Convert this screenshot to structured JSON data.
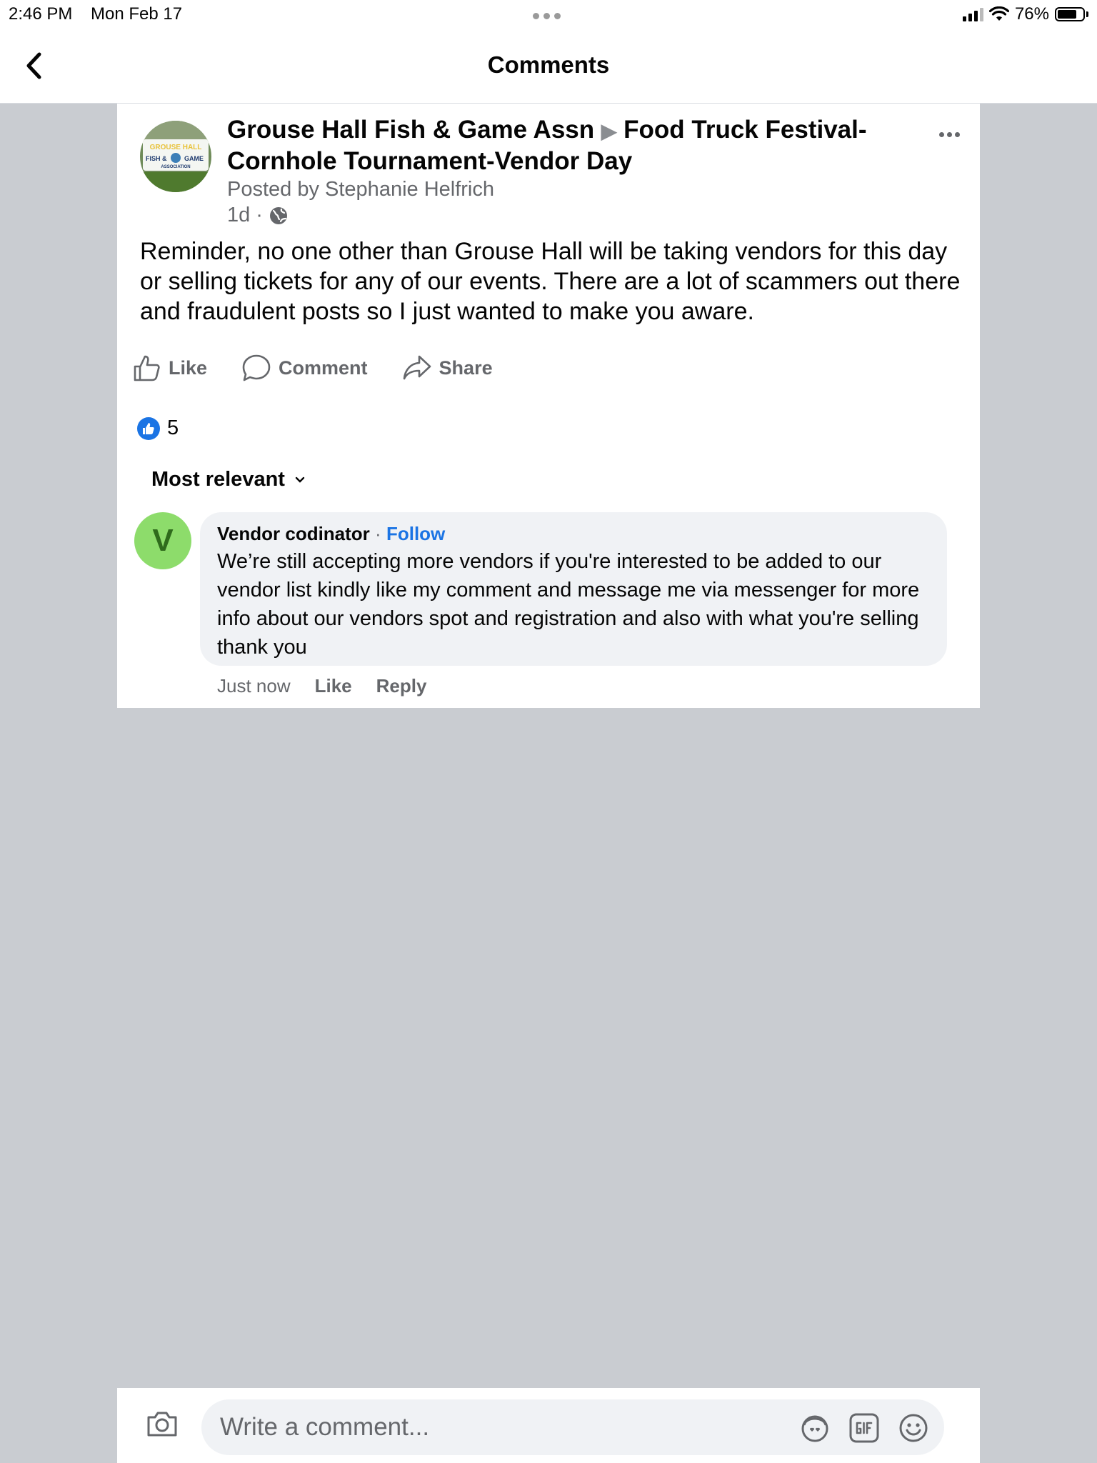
{
  "status_bar": {
    "time": "2:46 PM",
    "date": "Mon Feb 17",
    "battery": "76%"
  },
  "nav": {
    "title": "Comments",
    "back_icon": "chevron-left-icon"
  },
  "post": {
    "page_name": "Grouse Hall Fish & Game Assn",
    "event_name": "Food Truck Festival-Cornhole Tournament-Vendor Day",
    "posted_by": "Posted by Stephanie Helfrich",
    "time": "1d",
    "text": "Reminder, no one other than Grouse Hall will be taking vendors for this day or selling tickets for any of our events. There are a lot of scammers out there and fraudulent posts so I just wanted to make you aware.",
    "logo": {
      "text_top": "GROUSE HALL",
      "text_left": "FISH &",
      "text_right": "GAME",
      "text_bottom": "ASSOCIATION"
    },
    "actions": {
      "like": "Like",
      "comment": "Comment",
      "share": "Share"
    },
    "reaction_count": "5"
  },
  "sort": {
    "label": "Most relevant"
  },
  "comment": {
    "avatar_letter": "V",
    "author": "Vendor codinator",
    "separator": "·",
    "follow": "Follow",
    "text": "We’re still accepting more vendors if you're interested to be added to our vendor list kindly like my comment and message me via messenger for more info about our vendors spot and registration and also with what you're selling thank you",
    "time": "Just now",
    "like": "Like",
    "reply": "Reply"
  },
  "composer": {
    "placeholder": "Write a comment..."
  },
  "colors": {
    "accent": "#1b74e4",
    "background": "#c9ccd1",
    "comment_bubble": "#f0f2f5",
    "avatar_green": "#8ddc6b"
  }
}
